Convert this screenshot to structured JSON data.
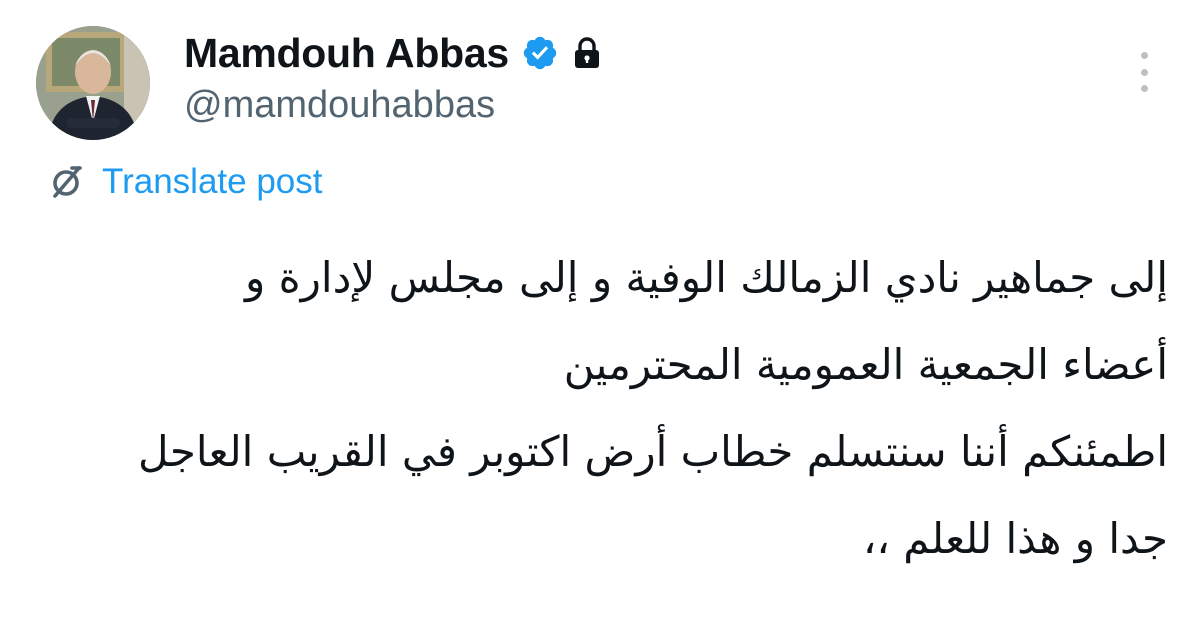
{
  "author": {
    "display_name": "Mamdouh Abbas",
    "handle": "@mamdouhabbas",
    "avatar_icon": "profile-photo",
    "verified_icon": "verified-badge-icon",
    "protected_icon": "lock-icon"
  },
  "actions": {
    "more_icon": "more-vertical-icon",
    "translate_icon": "translate-icon",
    "translate_label": "Translate post"
  },
  "post": {
    "lines": [
      "إلى جماهير نادي الزمالك الوفية و إلى مجلس لإدارة و",
      "أعضاء الجمعية العمومية المحترمين",
      "اطمئنكم أننا سنتسلم خطاب أرض اكتوبر في القريب العاجل",
      "جدا و هذا  للعلم ،،"
    ]
  },
  "colors": {
    "text": "#0f1419",
    "secondary_text": "#536471",
    "accent": "#1d9bf0",
    "verified": "#1d9bf0",
    "background": "#ffffff"
  }
}
